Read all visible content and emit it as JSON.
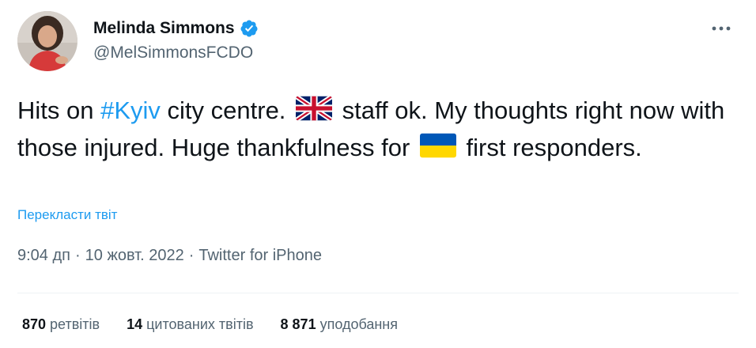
{
  "author": {
    "display_name": "Melinda Simmons",
    "handle": "@MelSimmonsFCDO",
    "verified": true
  },
  "tweet": {
    "part1": "Hits on ",
    "hashtag": "#Kyiv",
    "part2": " city centre. ",
    "flag1": "uk-flag",
    "part3": " staff ok. My thoughts right now with those injured. Huge thankfulness for ",
    "flag2": "ukraine-flag",
    "part4": " first responders."
  },
  "translate_label": "Перекласти твіт",
  "meta": {
    "time": "9:04 дп",
    "separator": "·",
    "date": "10 жовт. 2022",
    "source": "Twitter for iPhone"
  },
  "stats": {
    "retweets": {
      "count": "870",
      "label": "ретвітів"
    },
    "quotes": {
      "count": "14",
      "label": "цитованих твітів"
    },
    "likes": {
      "count": "8 871",
      "label": "уподобання"
    }
  },
  "colors": {
    "accent": "#1d9bf0",
    "text": "#0f1419",
    "secondary": "#536471"
  }
}
